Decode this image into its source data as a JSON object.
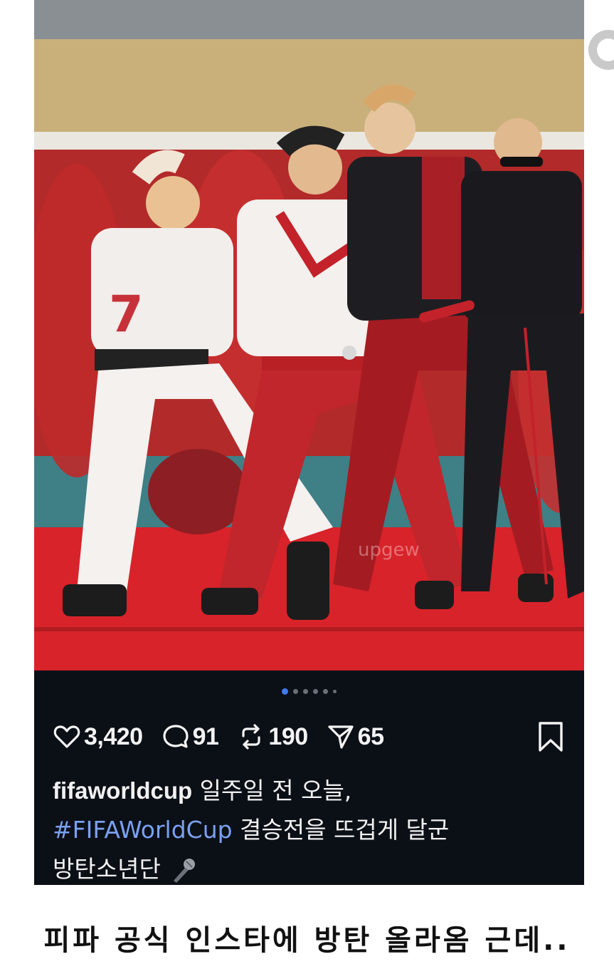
{
  "post": {
    "photo_alt": "Dancers in red and white outfits performing on a red stage in a stadium",
    "watermark": "upgew",
    "carousel": {
      "total_dots": 6,
      "active_index": 0
    },
    "stats": {
      "likes": "3,420",
      "comments": "91",
      "reposts": "190",
      "shares": "65"
    },
    "caption": {
      "username": "fifaworldcup",
      "text_1": " 일주일 전 오늘,",
      "hashtag": "#FIFAWorldCup",
      "text_2": " 결승전을 뜨겁게 달군",
      "text_3": "방탄소년단 "
    }
  },
  "footer": {
    "comment": "피파 공식 인스타에 방탄 올라옴 근데.."
  },
  "colors": {
    "post_bg": "#0b0f16",
    "hashtag": "#7aa0f0",
    "active_dot": "#3f7bf2",
    "stage_red": "#d8232a"
  },
  "icons": [
    "heart-icon",
    "comment-icon",
    "repost-icon",
    "share-icon",
    "bookmark-icon",
    "microphone-icon"
  ]
}
